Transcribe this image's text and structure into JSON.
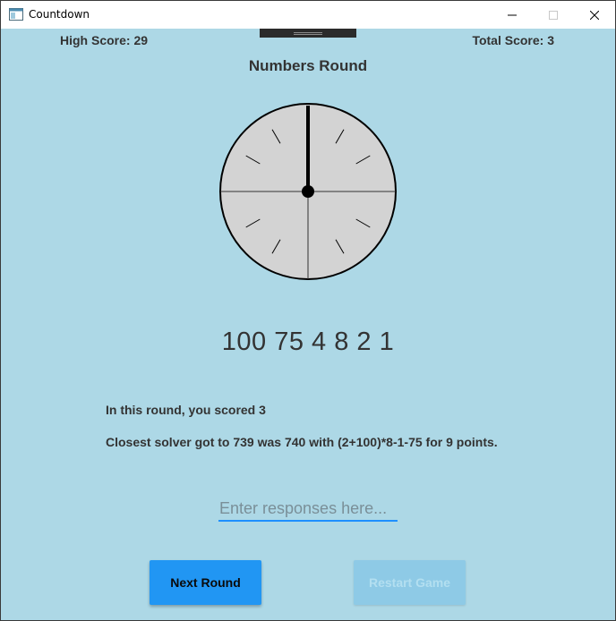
{
  "window": {
    "title": "Countdown"
  },
  "scores": {
    "high": "High Score: 29",
    "total": "Total Score: 3"
  },
  "round_title": "Numbers Round",
  "numbers": "100 75 4 8 2 1",
  "result": {
    "round_score": "In this round, you scored 3",
    "solver": "Closest solver got to 739 was 740 with (2+100)*8-1-75 for 9 points."
  },
  "input": {
    "placeholder": "Enter responses here...",
    "value": ""
  },
  "buttons": {
    "next": "Next Round",
    "restart": "Restart Game"
  },
  "colors": {
    "background": "#add8e6",
    "accent": "#2196f3",
    "disabled": "#8ecae6"
  },
  "icons": {
    "app": "app-window-icon",
    "minimize": "minimize-icon",
    "maximize": "maximize-icon",
    "close": "close-icon"
  }
}
